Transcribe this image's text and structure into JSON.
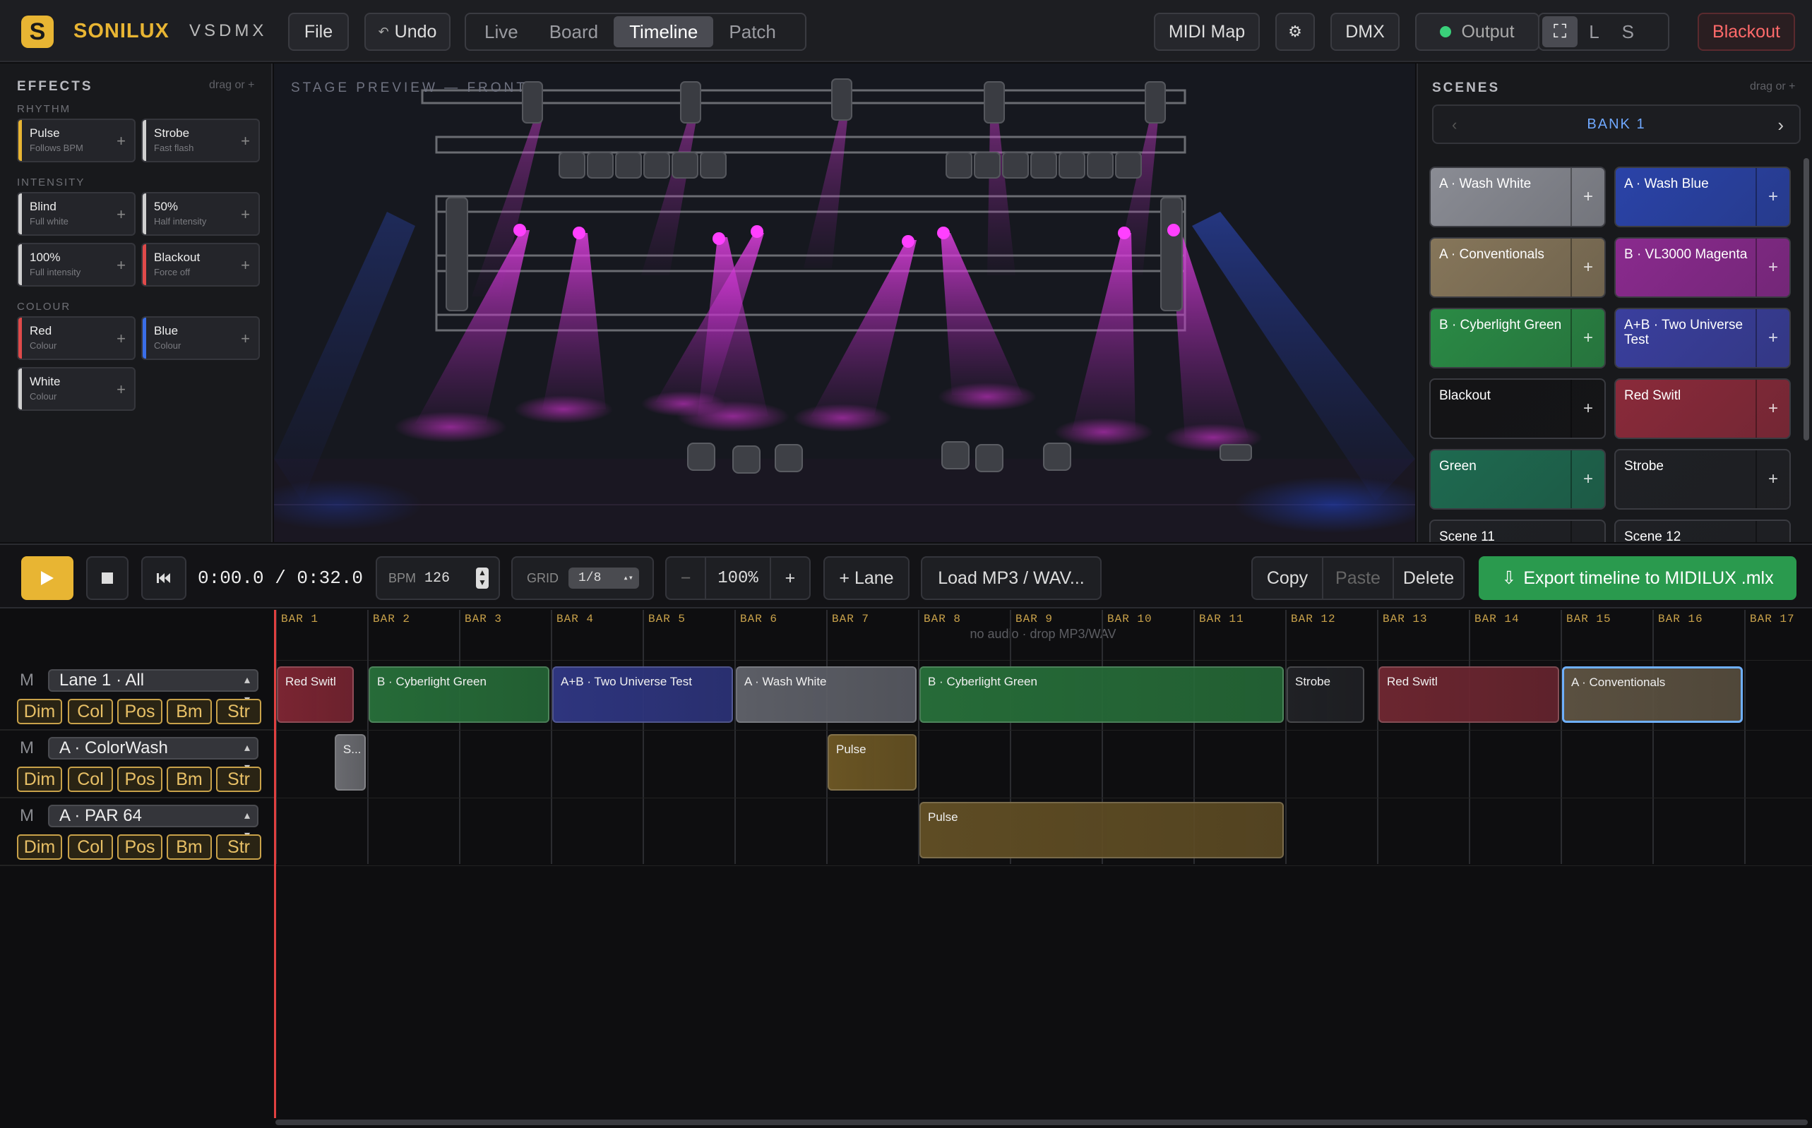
{
  "app": {
    "name": "SONILUX",
    "subtitle": "VSDMX"
  },
  "header": {
    "file": "File",
    "undo": "Undo",
    "undo_icon": "↶",
    "modes": [
      "Live",
      "Board",
      "Timeline",
      "Patch"
    ],
    "active_mode": "Timeline",
    "midi_map": "MIDI Map",
    "settings_icon": "⚙",
    "dmx": "DMX",
    "output": "Output",
    "size_modes": [
      "⛶",
      "L",
      "S"
    ],
    "blackout": "Blackout"
  },
  "effects": {
    "title": "EFFECTS",
    "hint": "drag or +",
    "groups": [
      {
        "name": "RHYTHM",
        "items": [
          {
            "name": "Pulse",
            "desc": "Follows BPM",
            "color": "#e8b533"
          },
          {
            "name": "Strobe",
            "desc": "Fast flash",
            "color": "#cfcfcf"
          }
        ]
      },
      {
        "name": "INTENSITY",
        "items": [
          {
            "name": "Blind",
            "desc": "Full white",
            "color": "#cfcfcf"
          },
          {
            "name": "50%",
            "desc": "Half intensity",
            "color": "#cfcfcf"
          },
          {
            "name": "100%",
            "desc": "Full intensity",
            "color": "#cfcfcf"
          },
          {
            "name": "Blackout",
            "desc": "Force off",
            "color": "#e04a4a"
          }
        ]
      },
      {
        "name": "COLOUR",
        "items": [
          {
            "name": "Red",
            "desc": "Colour",
            "color": "#e04a4a"
          },
          {
            "name": "Blue",
            "desc": "Colour",
            "color": "#3a6ee8"
          },
          {
            "name": "White",
            "desc": "Colour",
            "color": "#cfcfcf"
          }
        ]
      }
    ]
  },
  "stage": {
    "label": "STAGE PREVIEW — FRONT"
  },
  "scenes": {
    "title": "SCENES",
    "hint": "drag or +",
    "bank": "BANK 1",
    "items": [
      {
        "name": "A · Wash White",
        "color": "#8a8c94"
      },
      {
        "name": "A · Wash Blue",
        "color": "#2a43a8"
      },
      {
        "name": "A · Conventionals",
        "color": "#86765a"
      },
      {
        "name": "B · VL3000 Magenta",
        "color": "#8a2a8e"
      },
      {
        "name": "B · Cyberlight Green",
        "color": "#2a8a45"
      },
      {
        "name": "A+B · Two Universe Test",
        "color": "#3a3f9e"
      },
      {
        "name": "Blackout",
        "color": "#141416"
      },
      {
        "name": "Red Switl",
        "color": "#8a2a3a"
      },
      {
        "name": "Green",
        "color": "#1e6a50"
      },
      {
        "name": "Strobe",
        "color": "#1f2024"
      },
      {
        "name": "Scene 11",
        "color": "#1f2024"
      },
      {
        "name": "Scene 12",
        "color": "#1f2024"
      }
    ]
  },
  "transport": {
    "time": "0:00.0 / 0:32.0",
    "bpm_label": "BPM",
    "bpm": "126",
    "grid_label": "GRID",
    "grid": "1/8",
    "zoom_minus": "−",
    "zoom": "100%",
    "zoom_plus": "+",
    "add_lane": "+ Lane",
    "load_audio": "Load MP3 / WAV...",
    "copy": "Copy",
    "paste": "Paste",
    "delete": "Delete",
    "export": "Export timeline to MIDILUX .mlx",
    "export_icon": "⇩"
  },
  "timeline": {
    "bars": [
      "BAR 1",
      "BAR 2",
      "BAR 3",
      "BAR 4",
      "BAR 5",
      "BAR 6",
      "BAR 7",
      "BAR 8",
      "BAR 9",
      "BAR 10",
      "BAR 11",
      "BAR 12",
      "BAR 13",
      "BAR 14",
      "BAR 15",
      "BAR 16",
      "BAR 17"
    ],
    "audio_hint": "no audio · drop MP3/WAV",
    "lanes": [
      {
        "mute": "M",
        "name": "Lane 1 · All",
        "chips": [
          "Dim",
          "Col",
          "Pos",
          "Bm",
          "Str"
        ]
      },
      {
        "mute": "M",
        "name": "A · ColorWash",
        "chips": [
          "Dim",
          "Col",
          "Pos",
          "Bm",
          "Str"
        ]
      },
      {
        "mute": "M",
        "name": "A · PAR 64",
        "chips": [
          "Dim",
          "Col",
          "Pos",
          "Bm",
          "Str"
        ]
      }
    ],
    "clips": [
      {
        "lane": 0,
        "start": 1,
        "end": 1.87,
        "label": "Red Switl",
        "color": "#7a2532"
      },
      {
        "lane": 0,
        "start": 2,
        "end": 4,
        "label": "B · Cyberlight Green",
        "color": "#266b38"
      },
      {
        "lane": 0,
        "start": 4,
        "end": 6,
        "label": "A+B · Two Universe Test",
        "color": "#2e357e"
      },
      {
        "lane": 0,
        "start": 6,
        "end": 8,
        "label": "A · Wash White",
        "color": "#5c5e66"
      },
      {
        "lane": 0,
        "start": 8,
        "end": 12,
        "label": "B · Cyberlight Green",
        "color": "#266b38"
      },
      {
        "lane": 0,
        "start": 12,
        "end": 12.88,
        "label": "Strobe",
        "color": "#202125"
      },
      {
        "lane": 0,
        "start": 13,
        "end": 15,
        "label": "Red Switl",
        "color": "#6b2630"
      },
      {
        "lane": 0,
        "start": 15,
        "end": 17,
        "label": "A · Conventionals",
        "color": "#5a5040",
        "selected": true
      },
      {
        "lane": 1,
        "start": 1.63,
        "end": 2,
        "label": "S...",
        "color": "#6a6b70"
      },
      {
        "lane": 1,
        "start": 7,
        "end": 8,
        "label": "Pulse",
        "color": "#6a5524"
      },
      {
        "lane": 2,
        "start": 8,
        "end": 12,
        "label": "Pulse",
        "color": "#5e4c24"
      }
    ]
  }
}
